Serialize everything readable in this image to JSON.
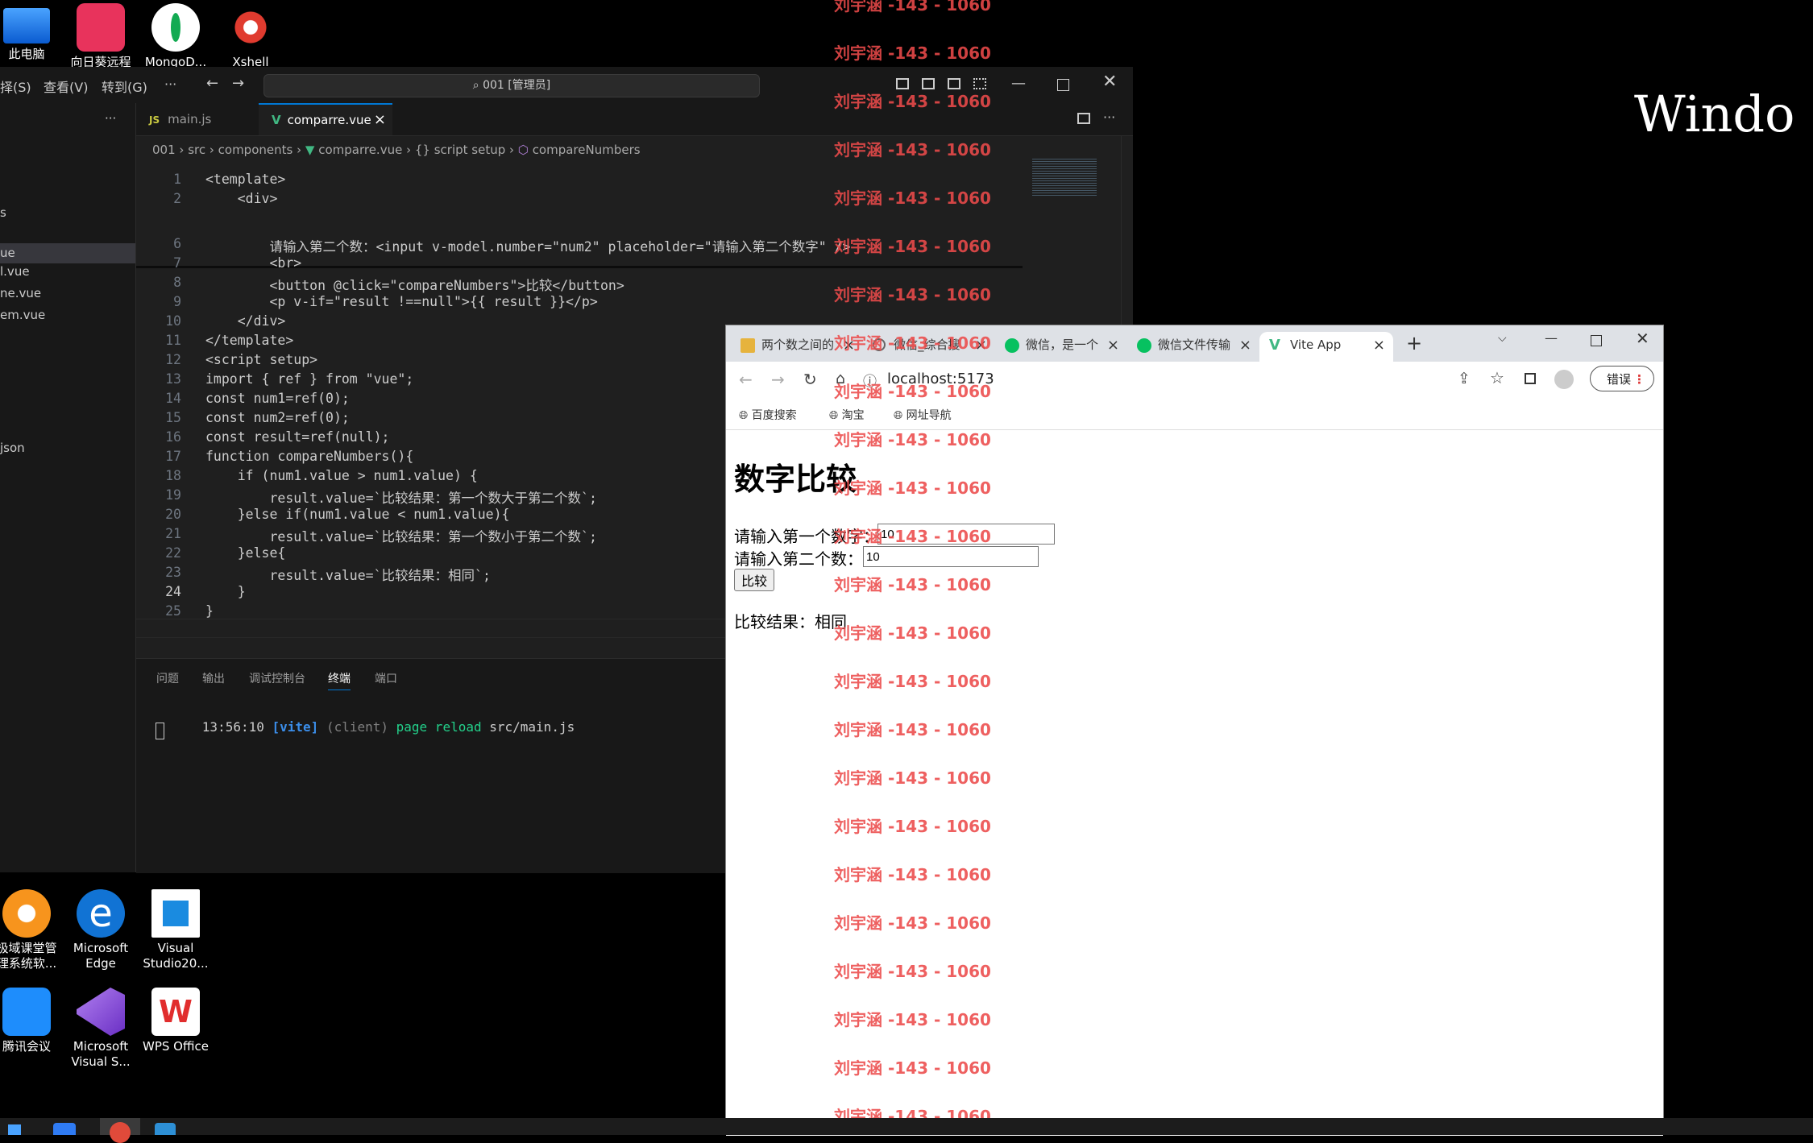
{
  "desktop": {
    "top_icons": [
      {
        "label": "此电脑"
      },
      {
        "label": "向日葵远程"
      },
      {
        "label": "MongoD..."
      },
      {
        "label": "Xshell"
      }
    ],
    "bottom_icons": [
      {
        "label": "极域课堂管\n理系统软..."
      },
      {
        "label": "Microsoft\nEdge"
      },
      {
        "label": "Visual\nStudio20..."
      },
      {
        "label": "腾讯会议"
      },
      {
        "label": "Microsoft\nVisual S..."
      },
      {
        "label": "WPS Office"
      }
    ],
    "right_text": "Windo"
  },
  "vscode": {
    "menu": [
      "择(S)",
      "查看(V)",
      "转到(G)",
      "···"
    ],
    "search_text": "001 [管理员]",
    "explorer_more": "···",
    "explorer_items": [
      "s",
      "ue",
      "l.vue",
      "ne.vue",
      "em.vue",
      "json"
    ],
    "tabs": [
      {
        "icon": "JS",
        "label": "main.js"
      },
      {
        "icon": "V",
        "label": "comparre.vue",
        "close": "×"
      }
    ],
    "breadcrumb": [
      "001",
      "src",
      "components",
      "comparre.vue",
      "{} script setup",
      "compareNumbers"
    ],
    "code_lines": [
      {
        "n": "1",
        "text": "<template>"
      },
      {
        "n": "2",
        "text": "    <div>"
      },
      {
        "n": "6",
        "text": "        请输入第二个数：<input v-model.number=\"num2\" placeholder=\"请输入第二个数字\" />"
      },
      {
        "n": "7",
        "text": "        <br>"
      },
      {
        "n": "8",
        "text": "        <button @click=\"compareNumbers\">比较</button>"
      },
      {
        "n": "9",
        "text": "        <p v-if=\"result !==null\">{{ result }}</p>"
      },
      {
        "n": "10",
        "text": "    </div>"
      },
      {
        "n": "11",
        "text": "</template>"
      },
      {
        "n": "12",
        "text": "<script setup>"
      },
      {
        "n": "13",
        "text": "import { ref } from \"vue\";"
      },
      {
        "n": "14",
        "text": "const num1=ref(0);"
      },
      {
        "n": "15",
        "text": "const num2=ref(0);"
      },
      {
        "n": "16",
        "text": "const result=ref(null);"
      },
      {
        "n": "17",
        "text": "function compareNumbers(){"
      },
      {
        "n": "18",
        "text": "    if (num1.value > num1.value) {"
      },
      {
        "n": "19",
        "text": "        result.value=`比较结果：第一个数大于第二个数`;"
      },
      {
        "n": "20",
        "text": "    }else if(num1.value < num1.value){"
      },
      {
        "n": "21",
        "text": "        result.value=`比较结果：第一个数小于第二个数`;"
      },
      {
        "n": "22",
        "text": "    }else{"
      },
      {
        "n": "23",
        "text": "        result.value=`比较结果：相同`;"
      },
      {
        "n": "24",
        "text": "    }"
      },
      {
        "n": "25",
        "text": "}"
      }
    ],
    "panel_tabs": [
      "问题",
      "输出",
      "调试控制台",
      "终端",
      "端口"
    ],
    "terminal": {
      "time": "13:56:10",
      "tag": "[vite]",
      "client": "(client)",
      "msg": "page reload",
      "path": "src/main.js"
    }
  },
  "browser": {
    "tabs": [
      {
        "label": "两个数之间的"
      },
      {
        "label": "微信_综合搜"
      },
      {
        "label": "微信，是一个"
      },
      {
        "label": "微信文件传输"
      },
      {
        "label": "Vite App"
      }
    ],
    "new_tab": "+",
    "url": "localhost:5173",
    "error_btn": "错误",
    "bookmarks": [
      "百度搜索",
      "淘宝",
      "网址导航"
    ],
    "page": {
      "heading": "数字比较",
      "label1": "请输入第一个数字：",
      "value1": "10",
      "label2": "请输入第二个数：",
      "value2": "10",
      "button": "比较",
      "result": "比较结果：相同"
    }
  },
  "watermark": "刘宇涵 -143 - 1060"
}
